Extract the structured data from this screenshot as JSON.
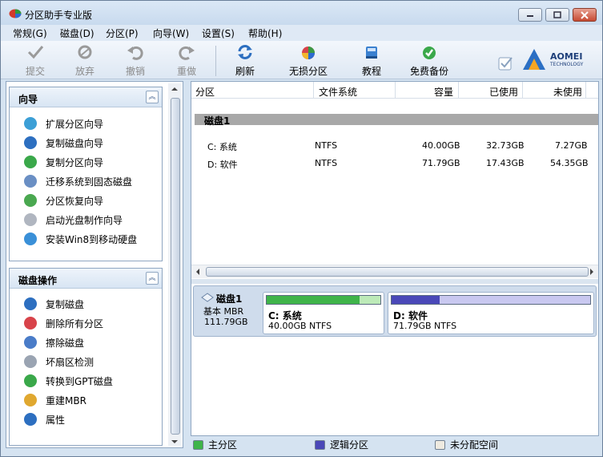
{
  "window": {
    "title": "分区助手专业版"
  },
  "menu": [
    "常规(G)",
    "磁盘(D)",
    "分区(P)",
    "向导(W)",
    "设置(S)",
    "帮助(H)"
  ],
  "toolbar": {
    "commit": "提交",
    "discard": "放弃",
    "undo": "撤销",
    "redo": "重做",
    "refresh": "刷新",
    "lossless": "无损分区",
    "tutorial": "教程",
    "backup": "免费备份"
  },
  "logo": {
    "brand": "AOMEI",
    "sub": "TECHNOLOGY"
  },
  "wizard_panel": {
    "title": "向导",
    "items": [
      "扩展分区向导",
      "复制磁盘向导",
      "复制分区向导",
      "迁移系统到固态磁盘",
      "分区恢复向导",
      "启动光盘制作向导",
      "安装Win8到移动硬盘"
    ]
  },
  "disk_panel": {
    "title": "磁盘操作",
    "items": [
      "复制磁盘",
      "删除所有分区",
      "擦除磁盘",
      "坏扇区检测",
      "转换到GPT磁盘",
      "重建MBR",
      "属性"
    ]
  },
  "table": {
    "headers": [
      "分区",
      "文件系统",
      "容量",
      "已使用",
      "未使用"
    ],
    "disk_label": "磁盘1",
    "rows": [
      {
        "name": "C: 系统",
        "fs": "NTFS",
        "capacity": "40.00GB",
        "used": "32.73GB",
        "free": "7.27GB"
      },
      {
        "name": "D: 软件",
        "fs": "NTFS",
        "capacity": "71.79GB",
        "used": "17.43GB",
        "free": "54.35GB"
      }
    ]
  },
  "diskmap": {
    "disk_name": "磁盘1",
    "disk_type": "基本 MBR",
    "disk_size": "111.79GB",
    "partitions": [
      {
        "name": "C: 系统",
        "detail": "40.00GB NTFS",
        "used_fraction": 0.82,
        "color": "#3fb44a"
      },
      {
        "name": "D: 软件",
        "detail": "71.79GB NTFS",
        "used_fraction": 0.24,
        "color": "#4a48b8"
      }
    ]
  },
  "legend": {
    "primary": "主分区",
    "logical": "逻辑分区",
    "unallocated": "未分配空间"
  },
  "colors": {
    "primary": "#3fb44a",
    "logical": "#4a48b8",
    "unallocated": "#eeeae0"
  }
}
